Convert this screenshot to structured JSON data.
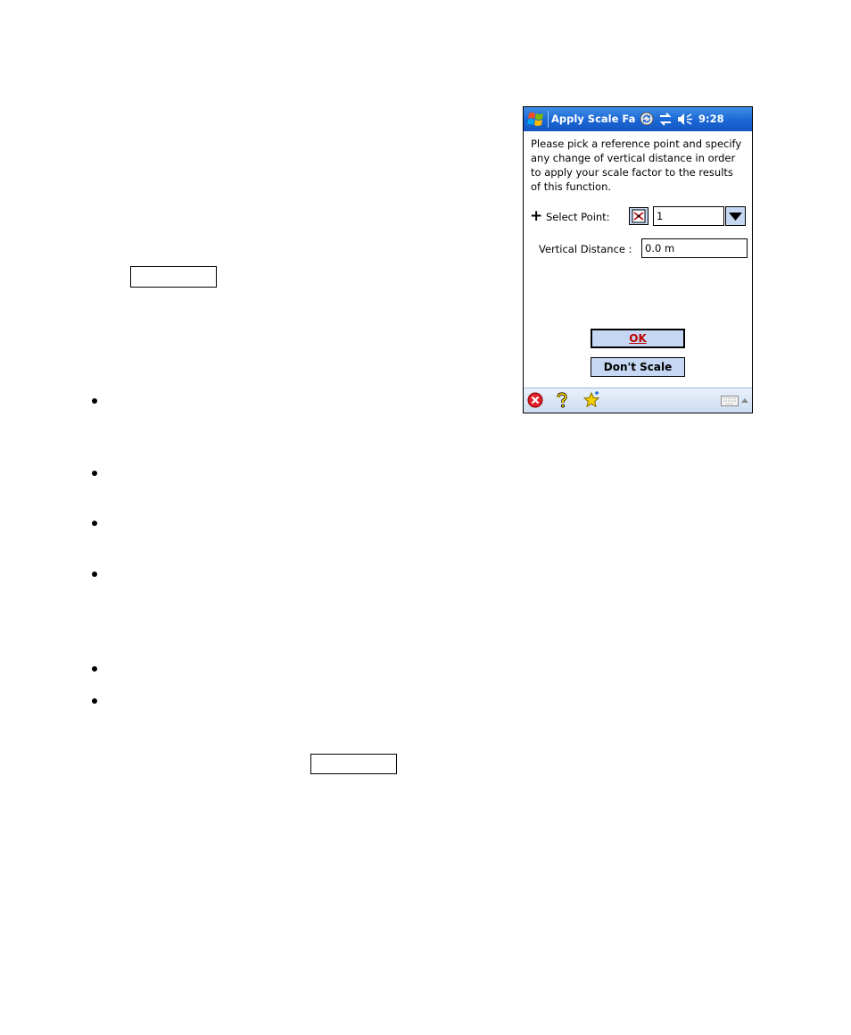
{
  "device": {
    "title_bar": {
      "app_title": "Apply Scale Fac",
      "clock": "9:28",
      "icons": [
        "windows-start-icon",
        "sync-icon",
        "connectivity-icon",
        "volume-icon"
      ]
    },
    "instructions": "Please pick a reference point and specify any change of vertical distance in order to apply your scale factor to the results of this function.",
    "select_point": {
      "label": "Select Point:",
      "value": "1"
    },
    "vertical_distance": {
      "label": "Vertical Distance :",
      "value": "0.0 m"
    },
    "buttons": {
      "ok": "OK",
      "dont_scale": "Don't Scale"
    },
    "bottom_bar": {
      "icons": [
        "close-icon",
        "help-icon",
        "favorites-icon",
        "keyboard-icon"
      ]
    }
  },
  "colors": {
    "title_bar": "#1a66d4",
    "button_fill": "#c5d7f2",
    "ok_text": "#c00000"
  }
}
